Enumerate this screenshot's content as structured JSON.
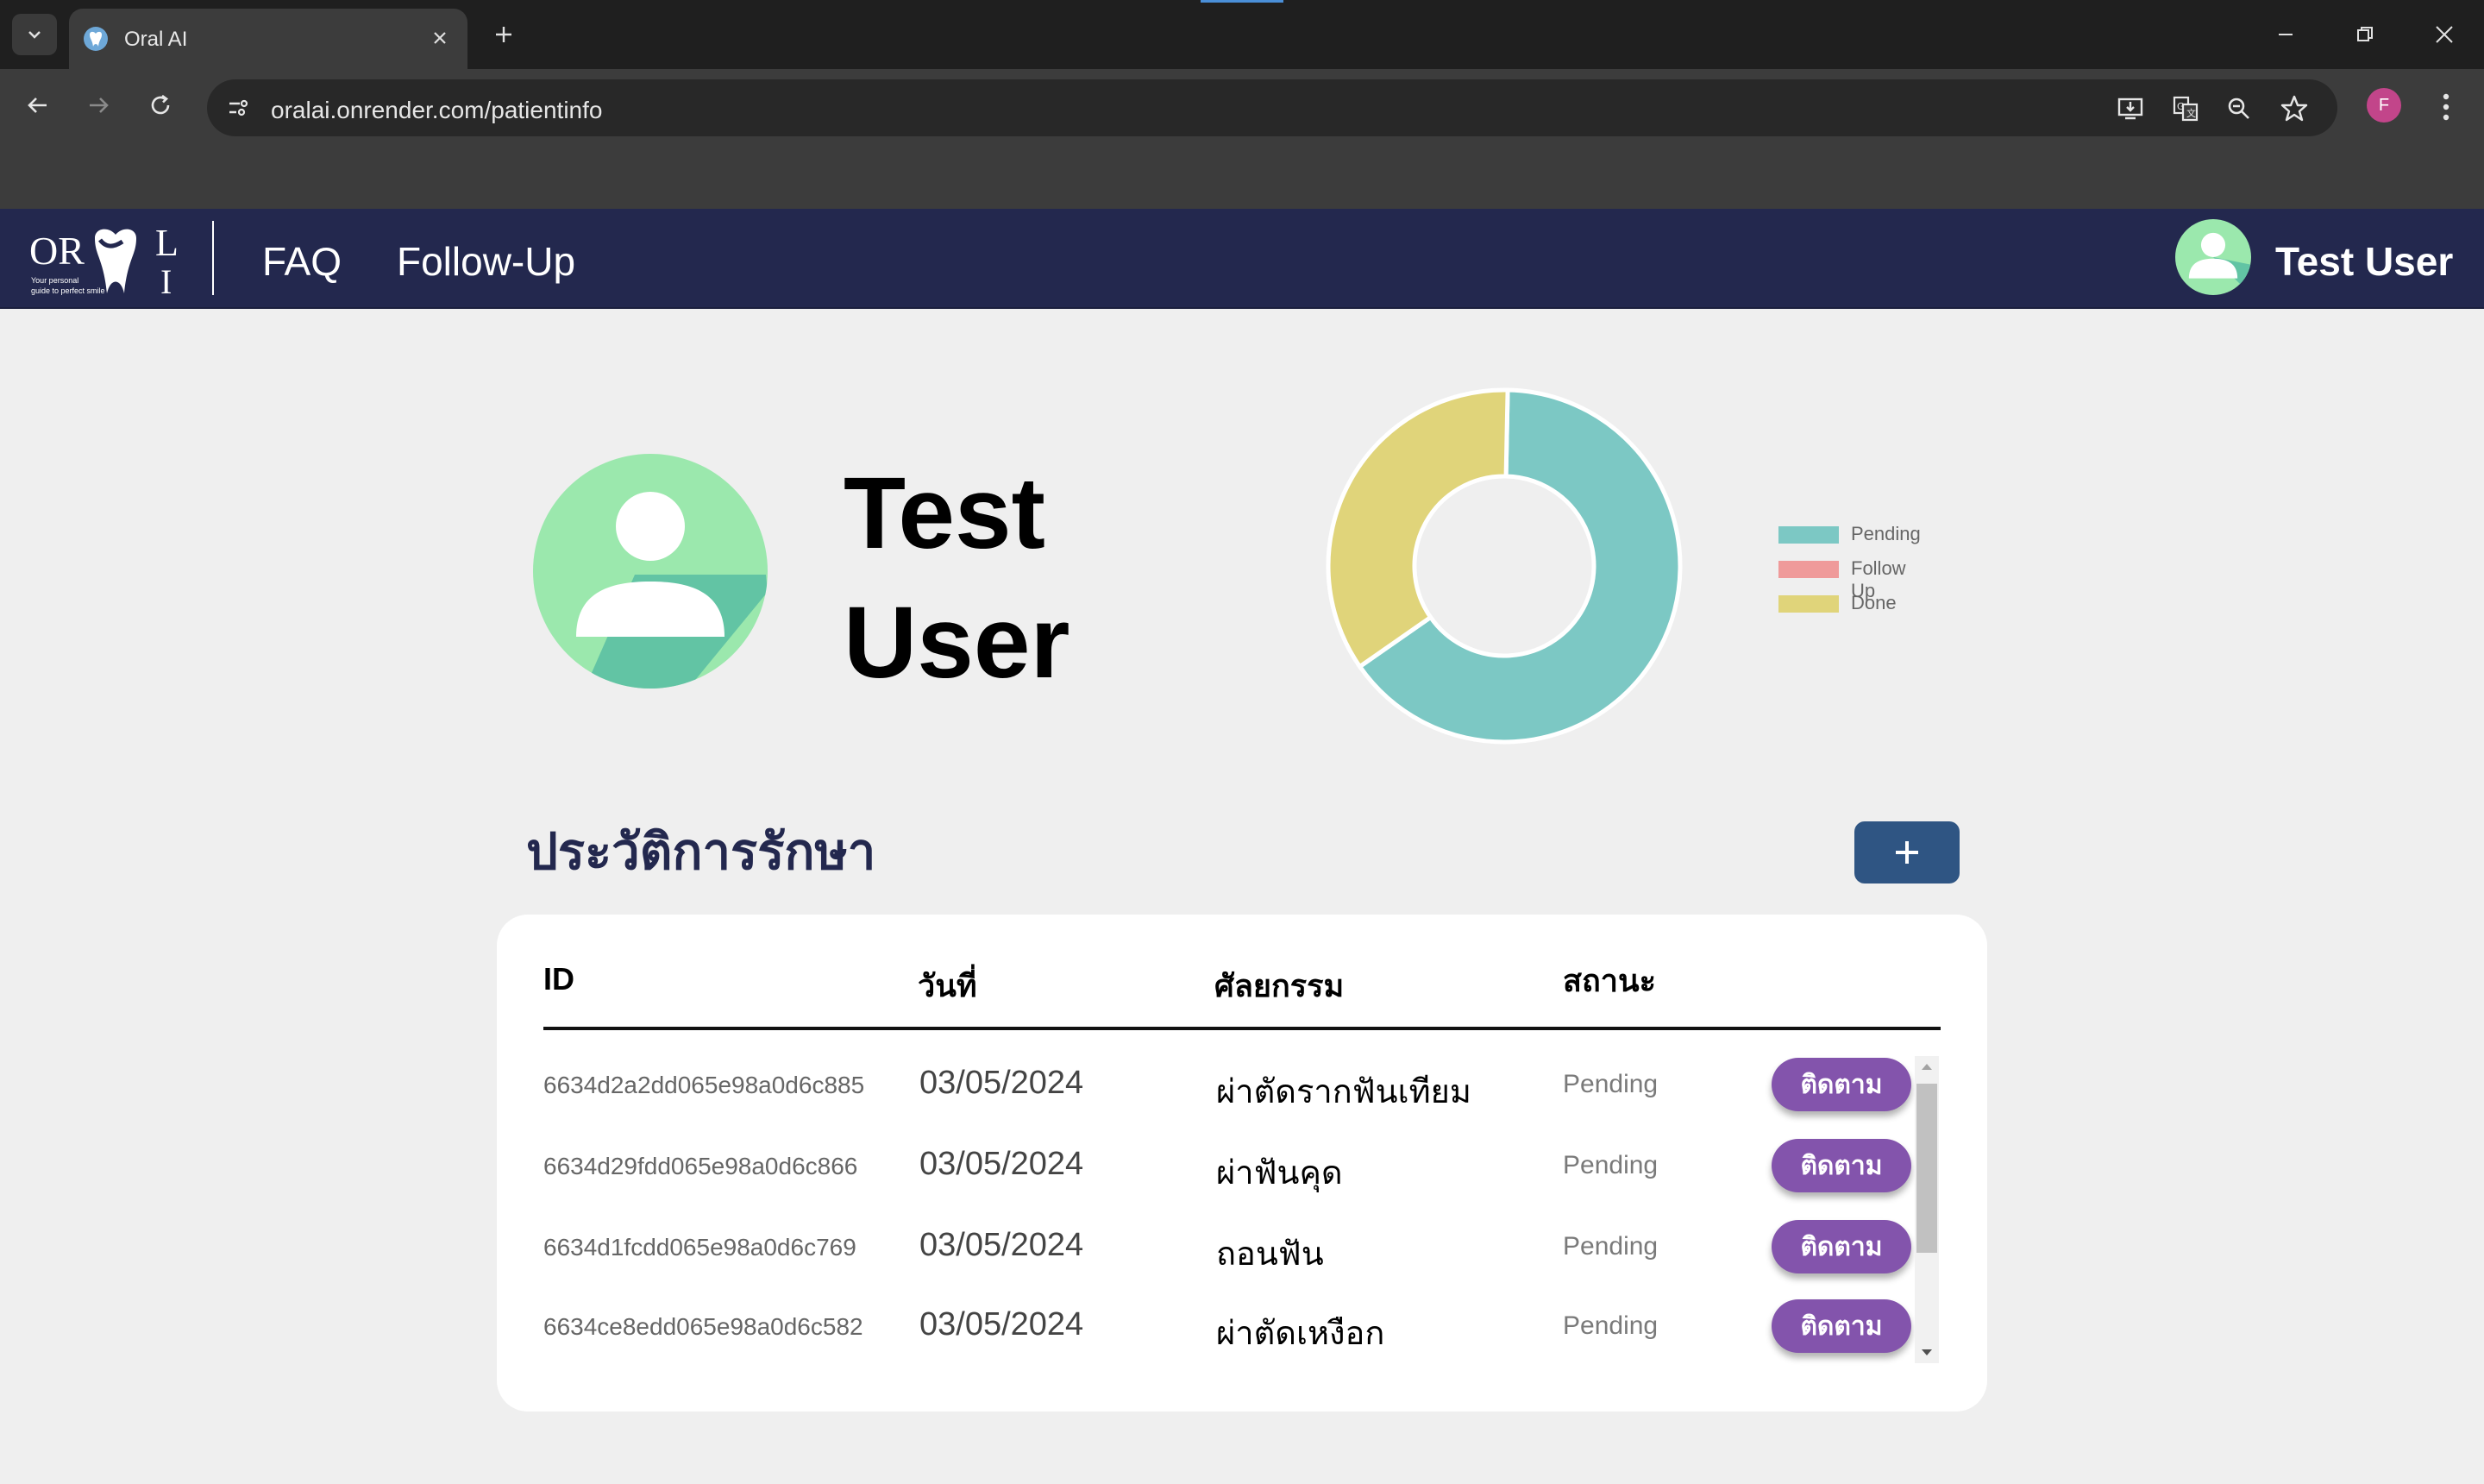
{
  "browser": {
    "tab_title": "Oral AI",
    "url": "oralai.onrender.com/patientinfo",
    "profile_initial": "F"
  },
  "nav": {
    "logo_text_left": "OR",
    "logo_text_right_top": "L",
    "logo_text_right_bottom": "I",
    "logo_tagline_1": "Your personal",
    "logo_tagline_2": "guide to perfect smile",
    "links": [
      "FAQ",
      "Follow-Up"
    ],
    "user_name": "Test User"
  },
  "profile": {
    "name_line1": "Test",
    "name_line2": "User"
  },
  "chart_data": {
    "type": "pie",
    "categories": [
      "Pending",
      "Follow Up",
      "Done"
    ],
    "values": [
      65,
      0,
      35
    ],
    "colors": [
      "#7cc8c4",
      "#ef9a9a",
      "#e0d47a"
    ],
    "legend_position": "right"
  },
  "history": {
    "title": "ประวัติการรักษา",
    "add_label": "+",
    "columns": [
      "ID",
      "วันที่",
      "ศัลยกรรม",
      "สถานะ"
    ],
    "action_label": "ติดตาม",
    "rows": [
      {
        "id": "6634d2a2dd065e98a0d6c885",
        "date": "03/05/2024",
        "procedure": "ผ่าตัดรากฟันเทียม",
        "status": "Pending"
      },
      {
        "id": "6634d29fdd065e98a0d6c866",
        "date": "03/05/2024",
        "procedure": "ผ่าฟันคุด",
        "status": "Pending"
      },
      {
        "id": "6634d1fcdd065e98a0d6c769",
        "date": "03/05/2024",
        "procedure": "ถอนฟัน",
        "status": "Pending"
      },
      {
        "id": "6634ce8edd065e98a0d6c582",
        "date": "03/05/2024",
        "procedure": "ผ่าตัดเหงือก",
        "status": "Pending"
      }
    ]
  }
}
